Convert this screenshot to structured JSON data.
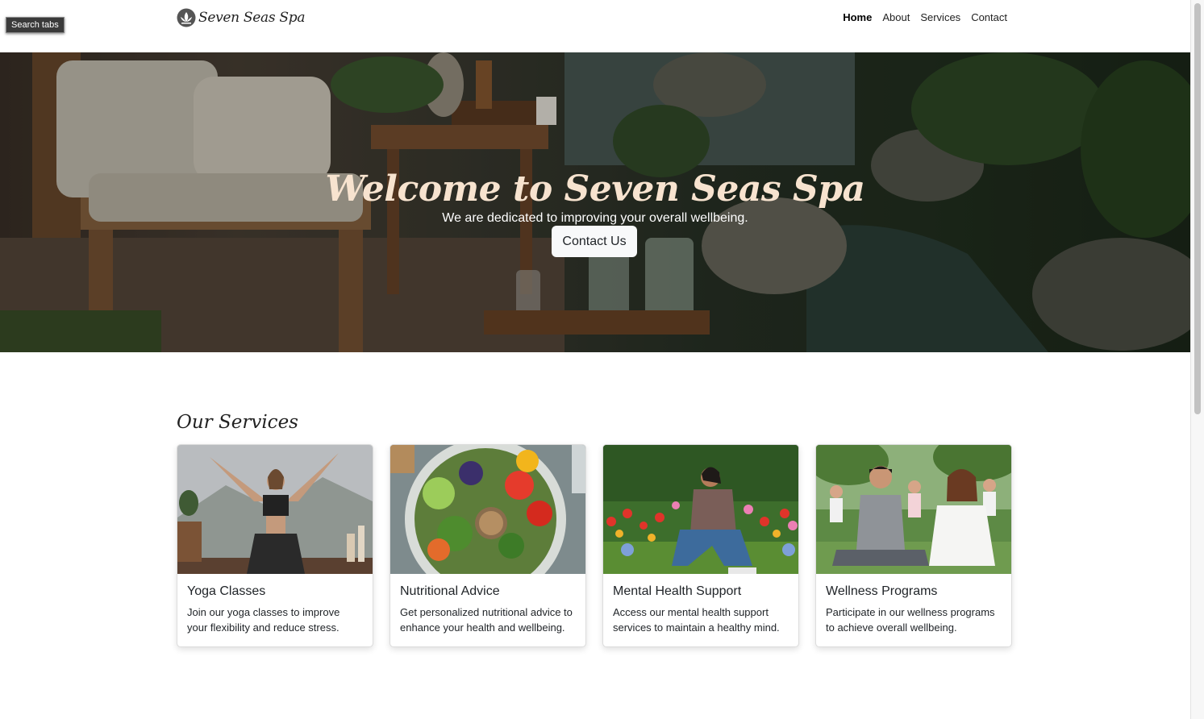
{
  "tooltip": {
    "text": "Search tabs"
  },
  "navbar": {
    "brand": "Seven Seas Spa",
    "links": [
      {
        "label": "Home",
        "active": true
      },
      {
        "label": "About",
        "active": false
      },
      {
        "label": "Services",
        "active": false
      },
      {
        "label": "Contact",
        "active": false
      }
    ]
  },
  "hero": {
    "title": "Welcome to Seven Seas Spa",
    "subtitle": "We are dedicated to improving your overall wellbeing.",
    "button_label": "Contact Us"
  },
  "services": {
    "heading": "Our Services",
    "cards": [
      {
        "title": "Yoga Classes",
        "text": "Join our yoga classes to improve your flexibility and reduce stress.",
        "image": "yoga-photo"
      },
      {
        "title": "Nutritional Advice",
        "text": "Get personalized nutritional advice to enhance your health and wellbeing.",
        "image": "salad-bowl-photo"
      },
      {
        "title": "Mental Health Support",
        "text": "Access our mental health support services to maintain a healthy mind.",
        "image": "garden-relaxing-photo"
      },
      {
        "title": "Wellness Programs",
        "text": "Participate in our wellness programs to achieve overall wellbeing.",
        "image": "group-meditation-photo"
      }
    ]
  },
  "colors": {
    "hero_title": "#f7e3cf",
    "button_bg": "#f8f9fa",
    "text": "#212529"
  }
}
